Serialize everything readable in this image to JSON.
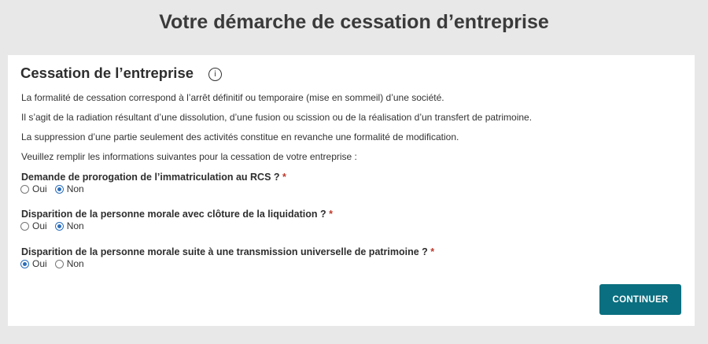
{
  "page": {
    "title": "Votre démarche de cessation d’entreprise"
  },
  "section": {
    "title": "Cessation de l’entreprise",
    "info_icon": "info-circle",
    "paragraphs": [
      "La formalité de cessation correspond à l’arrêt définitif ou temporaire (mise en sommeil) d’une société.",
      "Il s’agit de la radiation résultant d’une dissolution, d’une fusion ou scission ou de la réalisation d’un transfert de patrimoine.",
      "La suppression d’une partie seulement des activités constitue en revanche une formalité de modification.",
      "Veuillez remplir les informations suivantes pour la cessation de votre entreprise :"
    ]
  },
  "questions": [
    {
      "label": "Demande de prorogation de l’immatriculation au RCS ?",
      "required_mark": "*",
      "options": [
        "Oui",
        "Non"
      ],
      "selected": "Non"
    },
    {
      "label": "Disparition de la personne morale avec clôture de la liquidation ?",
      "required_mark": "*",
      "options": [
        "Oui",
        "Non"
      ],
      "selected": "Non"
    },
    {
      "label": "Disparition de la personne morale suite à une transmission universelle de patrimoine ?",
      "required_mark": "*",
      "options": [
        "Oui",
        "Non"
      ],
      "selected": "Oui"
    }
  ],
  "actions": {
    "continue_label": "CONTINUER"
  },
  "colors": {
    "accent": "#0a6f80",
    "radio_selected": "#2a6ebb",
    "required": "#c0392b",
    "background": "#e8e8e8"
  }
}
